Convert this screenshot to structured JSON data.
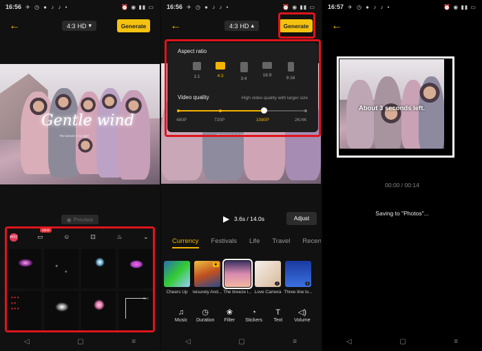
{
  "status_bar": [
    {
      "time": "16:56",
      "battery": "27"
    },
    {
      "time": "16:56",
      "battery": "27"
    },
    {
      "time": "16:57",
      "battery": "27"
    }
  ],
  "toolbar": {
    "ratio_label": "4:3",
    "quality_label": "HD",
    "generate_label": "Generate"
  },
  "preview": {
    "title_art": "Gentle wind",
    "subtitle_art": "The breeze is so light",
    "preview_label": "Preview"
  },
  "effects": {
    "tabs": [
      {
        "icon": "hot-icon",
        "badge": "HOT"
      },
      {
        "icon": "message-icon",
        "badge": "NEW"
      },
      {
        "icon": "character-icon"
      },
      {
        "icon": "cassette-icon"
      },
      {
        "icon": "ice-cream-icon"
      }
    ],
    "collapse_icon": "chevron-down-icon",
    "tiles": [
      "galaxy",
      "sparkles",
      "spotlight",
      "butterfly",
      "hearts",
      "bokeh",
      "glow",
      "rec-frame"
    ],
    "rec_label": "REC"
  },
  "aspect_panel": {
    "title": "Aspect ratio",
    "options": [
      {
        "label": "1:1"
      },
      {
        "label": "4:3"
      },
      {
        "label": "3:4"
      },
      {
        "label": "16:9"
      },
      {
        "label": "9:16"
      }
    ],
    "selected": "4:3",
    "quality_title": "Video quality",
    "quality_hint": "High video quality with larger size",
    "quality_levels": [
      "480P",
      "720P",
      "1080P",
      "2K/4K"
    ],
    "quality_selected": "1080P",
    "quality_fraction": 0.667
  },
  "player": {
    "time": "3.6s / 14.0s",
    "adjust_label": "Adjust"
  },
  "categories": [
    "Currency",
    "Festivals",
    "Life",
    "Travel",
    "Recen"
  ],
  "templates": [
    {
      "name": "Cheers Up"
    },
    {
      "name": "leisurely And..."
    },
    {
      "name": "The breeze i..."
    },
    {
      "name": "Love Camera"
    },
    {
      "name": "Three line lo..."
    }
  ],
  "tools": [
    {
      "label": "Music",
      "icon": "music-note-icon"
    },
    {
      "label": "Duration",
      "icon": "clock-icon"
    },
    {
      "label": "Filter",
      "icon": "filter-icon"
    },
    {
      "label": "Stickers",
      "icon": "sticker-icon"
    },
    {
      "label": "Text",
      "icon": "text-icon"
    },
    {
      "label": "Volume",
      "icon": "volume-icon"
    }
  ],
  "saving": {
    "progress_text": "About 3 seconds left.",
    "timecode": "00:00 / 00:14",
    "saving_text": "Saving to \"Photos\"..."
  },
  "colors": {
    "accent": "#f5b400",
    "highlight_box": "#e0141c",
    "background": "#111111"
  }
}
